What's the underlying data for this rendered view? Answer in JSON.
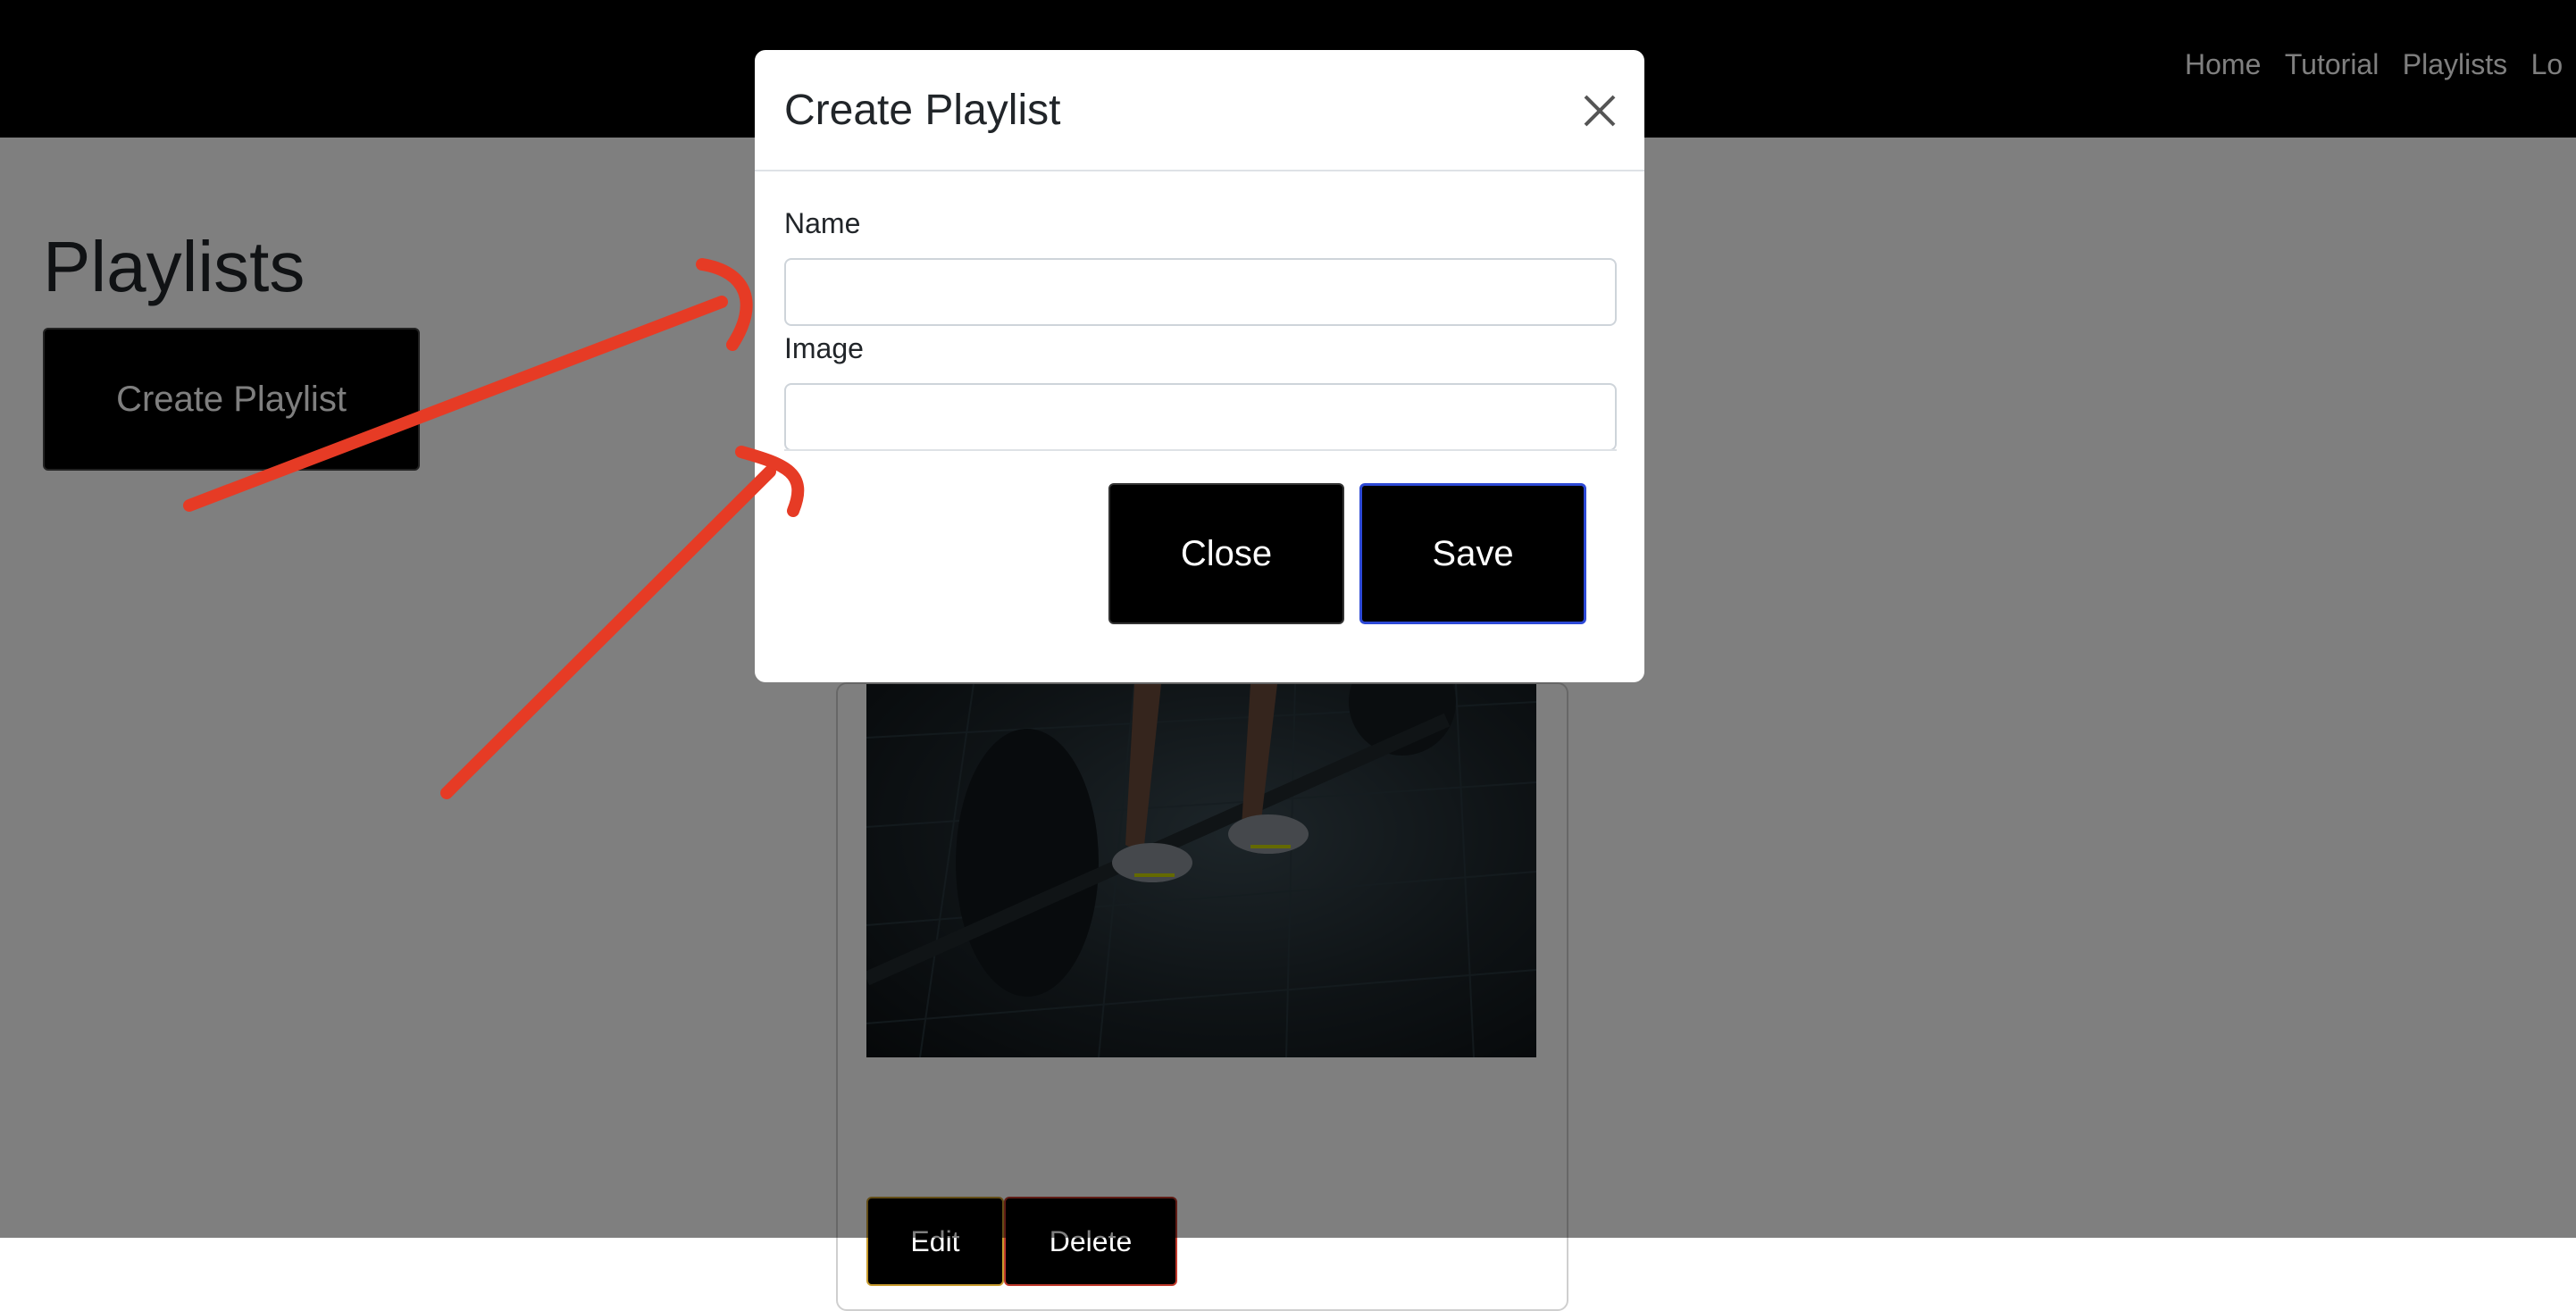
{
  "navbar": {
    "links": [
      "Home",
      "Tutorial",
      "Playlists",
      "Lo"
    ]
  },
  "page": {
    "title": "Playlists",
    "create_button_label": "Create Playlist"
  },
  "card": {
    "edit_label": "Edit",
    "delete_label": "Delete"
  },
  "modal": {
    "title": "Create Playlist",
    "name_label": "Name",
    "name_value": "",
    "image_label": "Image",
    "image_value": "",
    "close_label": "Close",
    "save_label": "Save"
  },
  "colors": {
    "navbar": "#000000",
    "button": "#000000",
    "annotation": "#e63b25",
    "save_border": "#2d49d6",
    "edit_border": "#c79b2e",
    "delete_border": "#c0392b"
  },
  "icons": {
    "close": "close-icon"
  }
}
